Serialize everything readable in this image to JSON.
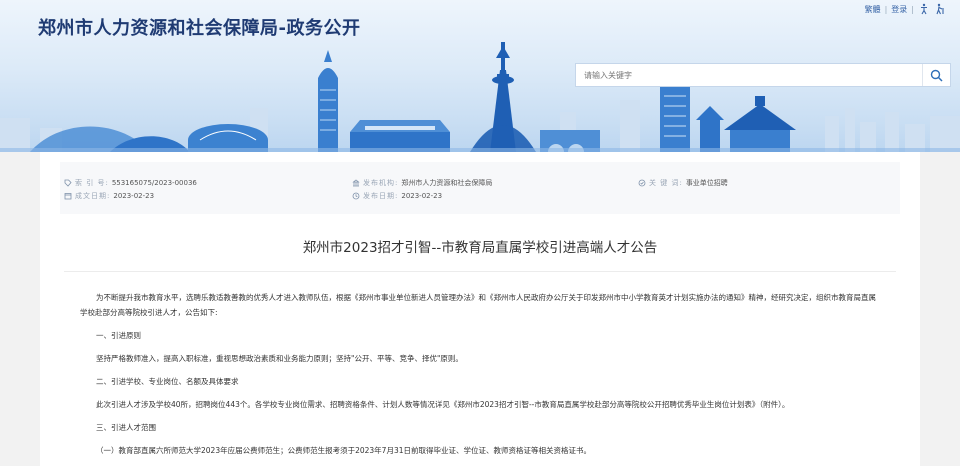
{
  "header": {
    "site_title": "郑州市人力资源和社会保障局-政务公开",
    "links": {
      "traditional": "繁體",
      "separator": "|",
      "login": "登录"
    },
    "icons": [
      "accessibility-icon",
      "elderly-mode-icon"
    ],
    "search": {
      "placeholder": "请输入关键字"
    }
  },
  "meta": {
    "index_label": "索 引 号:",
    "index_value": "553165075/2023-00036",
    "date_made_label": "成文日期:",
    "date_made_value": "2023-02-23",
    "publisher_label": "发布机构:",
    "publisher_value": "郑州市人力资源和社会保障局",
    "publish_date_label": "发布日期:",
    "publish_date_value": "2023-02-23",
    "keywords_label": "关 键 词:",
    "keywords_value": "事业单位招聘"
  },
  "article": {
    "title": "郑州市2023招才引智--市教育局直属学校引进高端人才公告",
    "paragraphs": [
      "为不断提升我市教育水平，选聘乐教适教善教的优秀人才进入教师队伍，根据《郑州市事业单位新进人员管理办法》和《郑州市人民政府办公厅关于印发郑州市中小学教育英才计划实施办法的通知》精神，经研究决定，组织市教育局直属学校赴部分高等院校引进人才，公告如下:",
      "一、引进原则",
      "坚持严格教师准入，提高入职标准，重视思想政治素质和业务能力原则；坚持\"公开、平等、竞争、择优\"原则。",
      "二、引进学校、专业岗位、名额及具体要求",
      "此次引进人才涉及学校40所，招聘岗位443个。各学校专业岗位需求、招聘资格条件、计划人数等情况详见《郑州市2023招才引智--市教育局直属学校赴部分高等院校公开招聘优秀毕业生岗位计划表》（附件）。",
      "三、引进人才范围",
      "（一）教育部直属六所师范大学2023年应届公费师范生；公费师范生报考须于2023年7月31日前取得毕业证、学位证、教师资格证等相关资格证书。"
    ]
  },
  "colors": {
    "title_blue": "#1f3b73",
    "link_blue": "#3a66a8",
    "banner_light": "#eef5fc",
    "banner_dark": "#bcd6f0"
  }
}
